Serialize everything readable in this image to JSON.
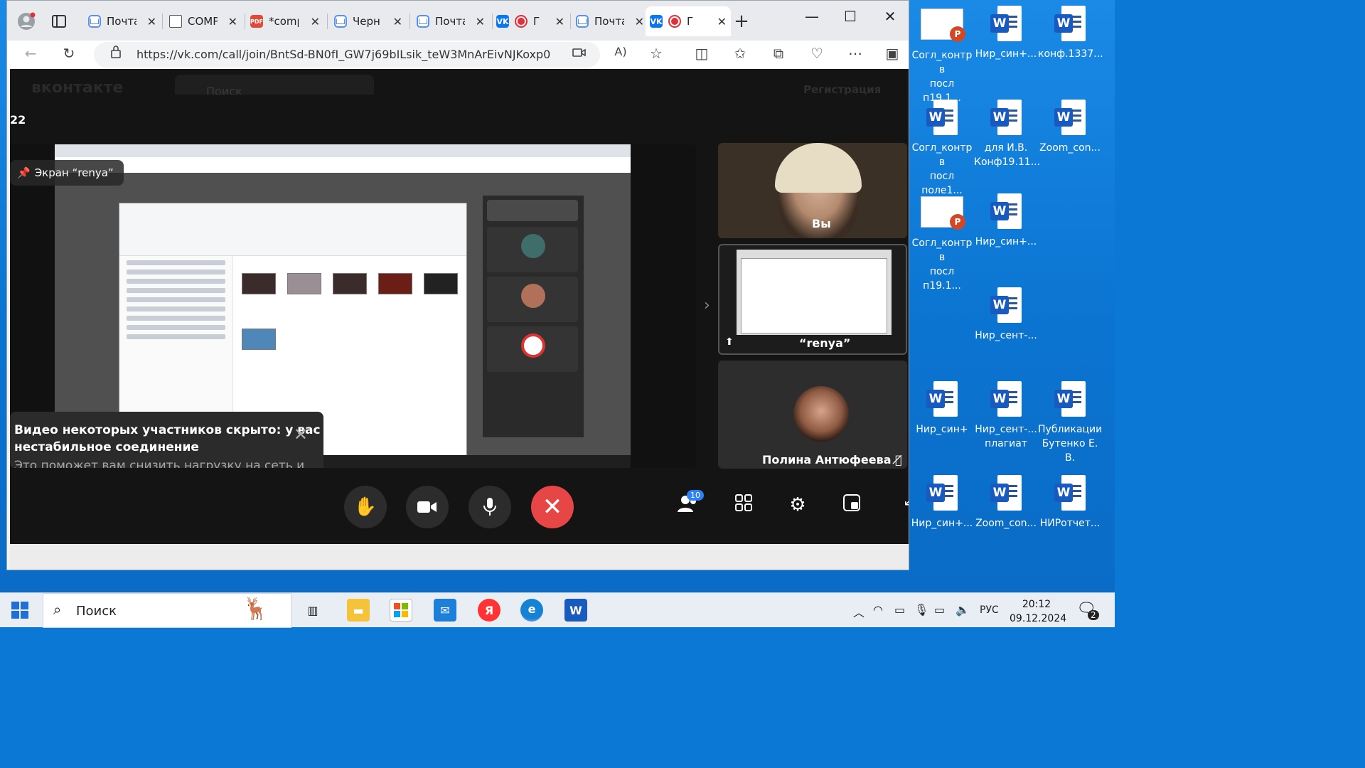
{
  "browser": {
    "tabs": [
      {
        "title": "Почта",
        "icon": "mail-icon"
      },
      {
        "title": "COMP",
        "icon": "document-icon"
      },
      {
        "title": "*comp",
        "icon": "pdf-icon"
      },
      {
        "title": "Черн",
        "icon": "mail-icon"
      },
      {
        "title": "Почта",
        "icon": "mail-icon"
      },
      {
        "title": "Г",
        "icon": "vk-icon"
      },
      {
        "title": "Почта",
        "icon": "mail-icon"
      },
      {
        "title": "Г",
        "icon": "vk-icon"
      }
    ],
    "url": "https://vk.com/call/join/BntSd-BN0fI_GW7j69bILsik_teW3MnArEivNJKoxp0",
    "accent": "#0a77f2"
  },
  "vk": {
    "logo": "вконтакте",
    "search_placeholder": "Поиск",
    "register": "Регистрация"
  },
  "call": {
    "partial_label": "22",
    "screen_label": "Экран “renya” ",
    "toast": {
      "title": "Видео некоторых участников скрыто: у вас нестабильное соединение",
      "body": "Это поможет вам снизить нагрузку на сеть и оставаться в звонке"
    },
    "participants": [
      {
        "name": "Вы"
      },
      {
        "name": "“renya” "
      },
      {
        "name": "Полина Антюфеева"
      }
    ],
    "participants_count": "10",
    "end_color": "#e64646"
  },
  "desktop_icons": [
    {
      "line1": "Согл_контр в",
      "line2": "посл п19.1...",
      "type": "ppt"
    },
    {
      "line1": "Нир_син+...",
      "line2": "",
      "type": "word"
    },
    {
      "line1": "конф.1337...",
      "line2": "",
      "type": "word"
    },
    {
      "line1": "Согл_контр в",
      "line2": "посл поле1...",
      "type": "word"
    },
    {
      "line1": "для И.В.",
      "line2": "Конф19.11...",
      "type": "word"
    },
    {
      "line1": "Zoom_con...",
      "line2": "",
      "type": "word"
    },
    {
      "line1": "Согл_контр в",
      "line2": "посл п19.1...",
      "type": "ppt"
    },
    {
      "line1": "Нир_син+...",
      "line2": "",
      "type": "word"
    },
    {
      "line1": "Нир_сент-...",
      "line2": "",
      "type": "word"
    },
    {
      "line1": "Нир_син+",
      "line2": "",
      "type": "word"
    },
    {
      "line1": "Нир_сент-...",
      "line2": "плагиат",
      "type": "word"
    },
    {
      "line1": "Публикации",
      "line2": "Бутенко Е. В.",
      "type": "word"
    },
    {
      "line1": "Нир_син+...",
      "line2": "",
      "type": "word"
    },
    {
      "line1": "Zoom_con...",
      "line2": "",
      "type": "word"
    },
    {
      "line1": "НИРотчет...",
      "line2": "",
      "type": "word"
    }
  ],
  "taskbar": {
    "search": "Поиск",
    "lang": "РУС",
    "time": "20:12",
    "date": "09.12.2024",
    "notifications": "2"
  }
}
